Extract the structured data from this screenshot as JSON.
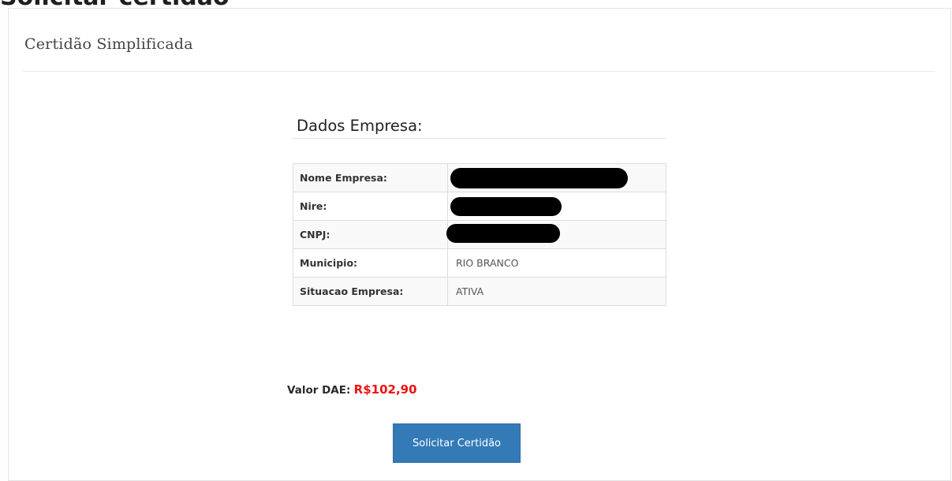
{
  "page": {
    "heading": "Solicitar certidão"
  },
  "panel": {
    "title": "Certidão Simplificada"
  },
  "company_section": {
    "heading": "Dados Empresa:",
    "rows": [
      {
        "label": "Nome Empresa:",
        "value": "",
        "redacted": true
      },
      {
        "label": "Nire:",
        "value": "",
        "redacted": true
      },
      {
        "label": "CNPJ:",
        "value": "",
        "redacted": true
      },
      {
        "label": "Municipio:",
        "value": "RIO BRANCO",
        "redacted": false
      },
      {
        "label": "Situacao Empresa:",
        "value": "ATIVA",
        "redacted": false
      }
    ]
  },
  "payment": {
    "label": "Valor DAE:",
    "amount": "R$102,90",
    "amount_color": "#ee1111"
  },
  "actions": {
    "submit_label": "Solicitar Certidão",
    "submit_color": "#337ab7"
  }
}
